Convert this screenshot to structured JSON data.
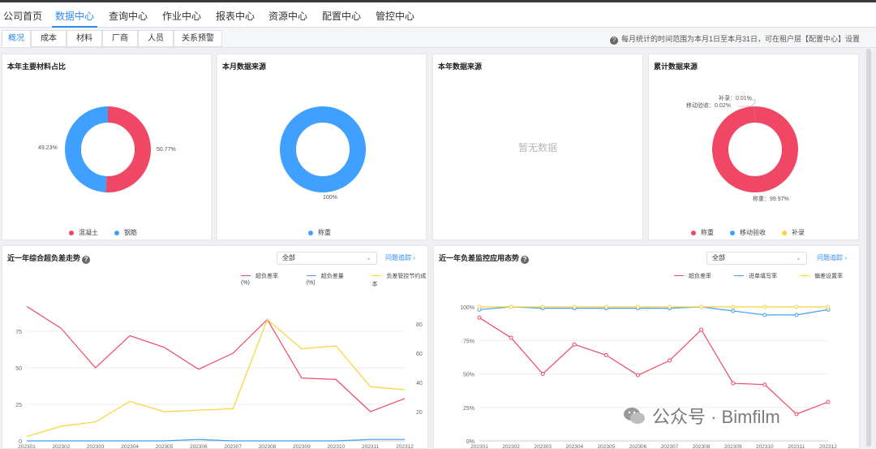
{
  "nav": {
    "items": [
      "公司首页",
      "数据中心",
      "查询中心",
      "作业中心",
      "报表中心",
      "资源中心",
      "配置中心",
      "管控中心"
    ],
    "active_index": 1
  },
  "subtabs": {
    "items": [
      "概况",
      "成本",
      "材料",
      "厂商",
      "人员",
      "关系预警"
    ],
    "active_index": 0
  },
  "notice": "每月统计的时间范围为本月1日至本月31日，可在租户层【配置中心】设置",
  "colors": {
    "red": "#f04864",
    "blue": "#3fa0ff",
    "yellow": "#fad337",
    "accent": "#2d8cf0"
  },
  "card1": {
    "title": "本年主要材料占比",
    "labels": {
      "left": "49.23%",
      "right": "50.77%"
    },
    "legend": [
      "混凝土",
      "钢筋"
    ]
  },
  "card2": {
    "title": "本月数据来源",
    "labels": {
      "bottom": "100%"
    },
    "legend": [
      "称重"
    ]
  },
  "card3": {
    "title": "本年数据来源",
    "nodata": "暂无数据"
  },
  "card4": {
    "title": "累计数据来源",
    "labels": {
      "top1": "补录：0.01%",
      "top2": "移动验收：0.02%",
      "bottom": "称重：99.97%"
    },
    "legend": [
      "称重",
      "移动验收",
      "补录"
    ]
  },
  "trend1": {
    "title": "近一年综合超负差走势",
    "select": "全部",
    "link": "问题追踪",
    "legend": [
      "超负差率(%)",
      "超负差量(%)",
      "负差管控节约成本"
    ]
  },
  "trend2": {
    "title": "近一年负差监控应用态势",
    "select": "全部",
    "link": "问题追踪",
    "legend": [
      "超负差率",
      "进单填写率",
      "偏差设置率"
    ]
  },
  "watermark": "公众号 · Bimfilm",
  "chart_data": [
    {
      "type": "pie",
      "title": "本年主要材料占比",
      "categories": [
        "混凝土",
        "钢筋"
      ],
      "values": [
        50.77,
        49.23
      ]
    },
    {
      "type": "pie",
      "title": "本月数据来源",
      "categories": [
        "称重"
      ],
      "values": [
        100
      ]
    },
    {
      "type": "pie",
      "title": "累计数据来源",
      "categories": [
        "称重",
        "移动验收",
        "补录"
      ],
      "values": [
        99.97,
        0.02,
        0.01
      ]
    },
    {
      "type": "line",
      "title": "近一年综合超负差走势",
      "x": [
        "202301",
        "202302",
        "202303",
        "202304",
        "202305",
        "202306",
        "202307",
        "202308",
        "202309",
        "202310",
        "202311",
        "202312"
      ],
      "ylim": [
        0,
        100
      ],
      "yticks": [
        "0",
        "25",
        "50",
        "75"
      ],
      "y2lim": [
        0,
        100
      ],
      "y2ticks": [
        "20",
        "40",
        "60",
        "80"
      ],
      "series": [
        {
          "name": "超负差率(%)",
          "axis": "left",
          "values": [
            92,
            77,
            50,
            72,
            64,
            49,
            60,
            83,
            43,
            42,
            20,
            29
          ]
        },
        {
          "name": "超负差量(%)",
          "axis": "left",
          "values": [
            0,
            0,
            0,
            0,
            0,
            1,
            0,
            0,
            0,
            0,
            1,
            1
          ]
        },
        {
          "name": "负差管控节约成本",
          "axis": "right",
          "values": [
            3,
            10,
            13,
            27,
            20,
            21,
            22,
            83,
            63,
            65,
            37,
            35
          ]
        }
      ]
    },
    {
      "type": "line",
      "title": "近一年负差监控应用态势",
      "x": [
        "202301",
        "202302",
        "202303",
        "202304",
        "202305",
        "202306",
        "202307",
        "202308",
        "202309",
        "202310",
        "202311",
        "202312"
      ],
      "ylim": [
        0,
        100
      ],
      "yticks": [
        "0%",
        "25%",
        "50%",
        "75%",
        "100%"
      ],
      "series": [
        {
          "name": "超负差率",
          "values": [
            92,
            77,
            50,
            72,
            64,
            49,
            60,
            83,
            43,
            42,
            20,
            29
          ]
        },
        {
          "name": "进单填写率",
          "values": [
            98,
            100,
            99,
            99,
            99,
            99,
            99,
            100,
            97,
            94,
            94,
            98
          ]
        },
        {
          "name": "偏差设置率",
          "values": [
            100,
            100,
            100,
            100,
            100,
            100,
            100,
            100,
            100,
            100,
            100,
            100
          ]
        }
      ]
    }
  ]
}
